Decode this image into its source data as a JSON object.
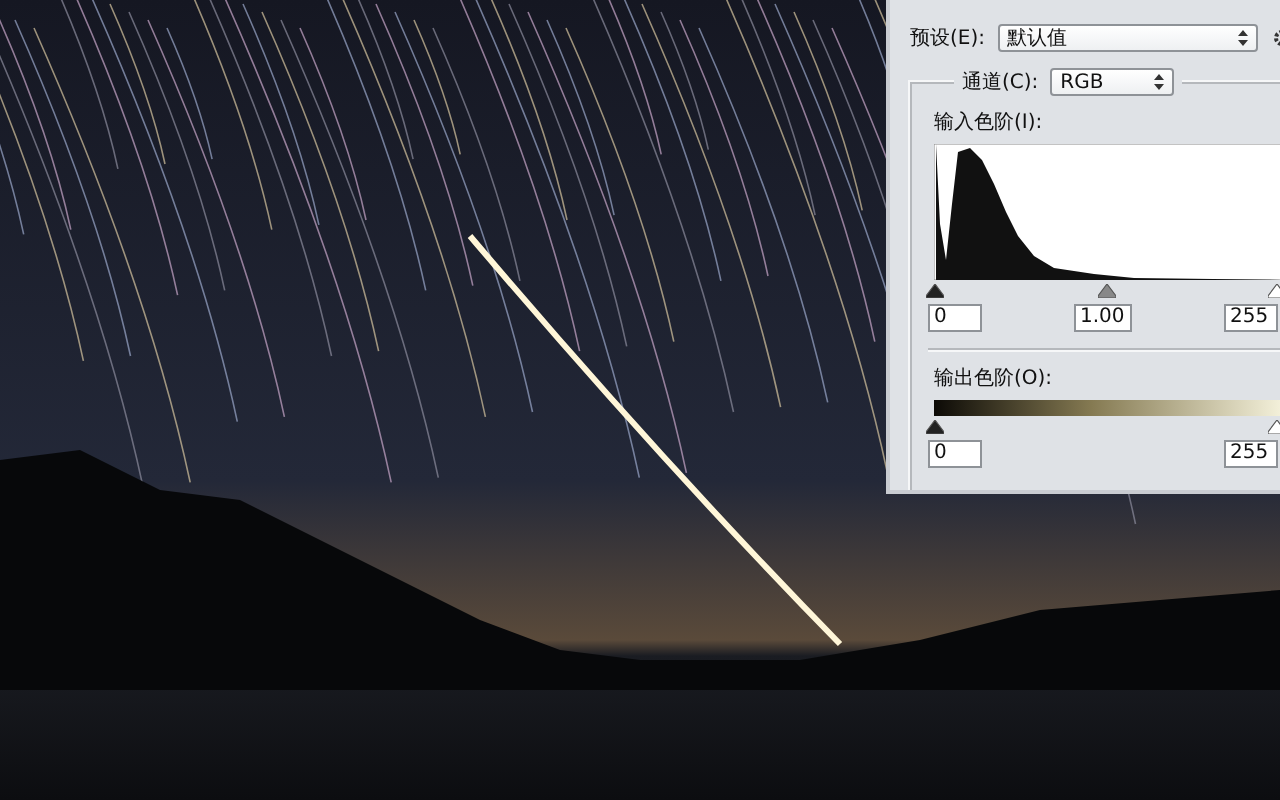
{
  "levels_dialog": {
    "preset": {
      "label": "预设(E):",
      "value": "默认值"
    },
    "channel": {
      "label": "通道(C):",
      "value": "RGB"
    },
    "input_levels": {
      "label": "输入色阶(I):",
      "values": [
        "0",
        "1.00",
        "255"
      ]
    },
    "output_levels": {
      "label": "输出色阶(O):",
      "values": [
        "0",
        "255"
      ]
    }
  }
}
